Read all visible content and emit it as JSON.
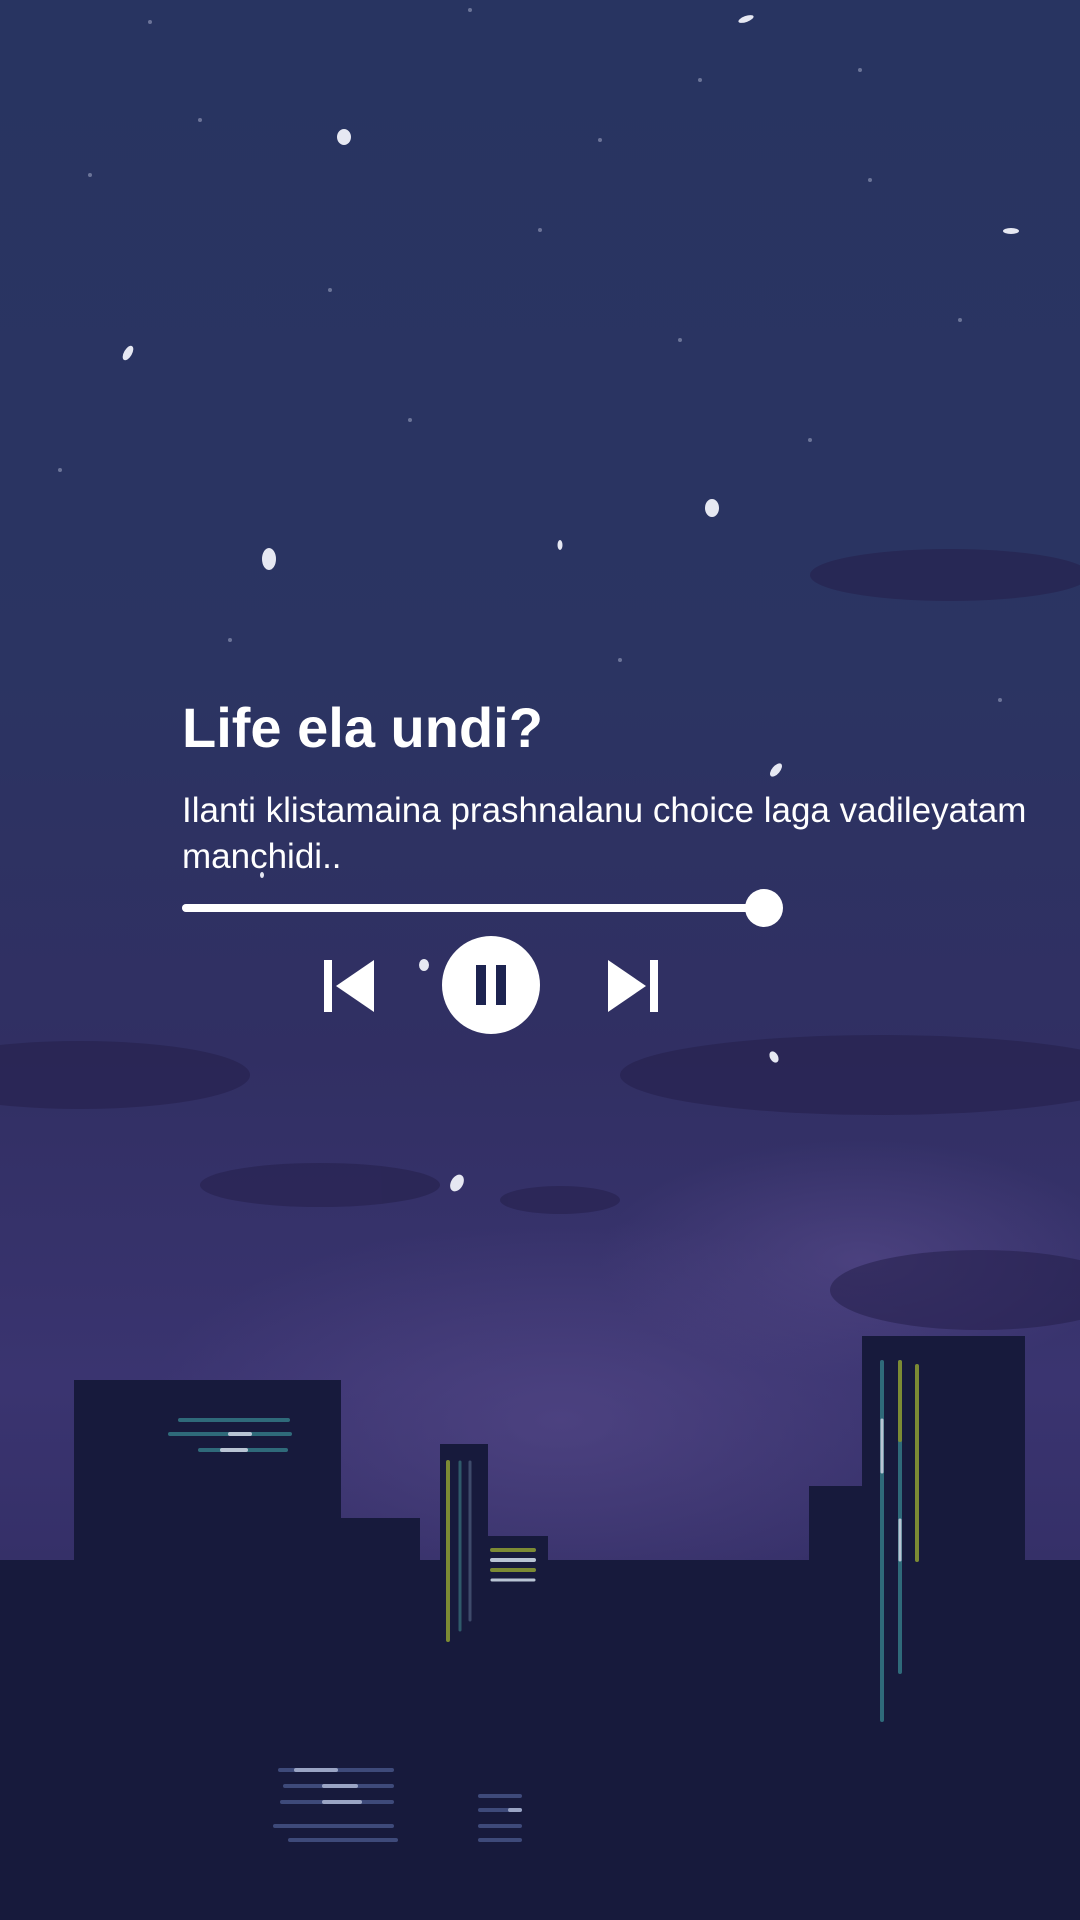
{
  "track": {
    "title": "Life ela undi?",
    "subtitle": "Ilanti klistamaina prashnalanu choice laga vadileyatam manchidi..",
    "progress": 0.97
  },
  "controls": {
    "previous_icon": "skip-previous-icon",
    "play_pause_icon": "pause-icon",
    "next_icon": "skip-next-icon"
  },
  "colors": {
    "sky_top": "#283461",
    "sky_mid": "#332f66",
    "city": "#171a3c",
    "foreground": "#ffffff"
  }
}
